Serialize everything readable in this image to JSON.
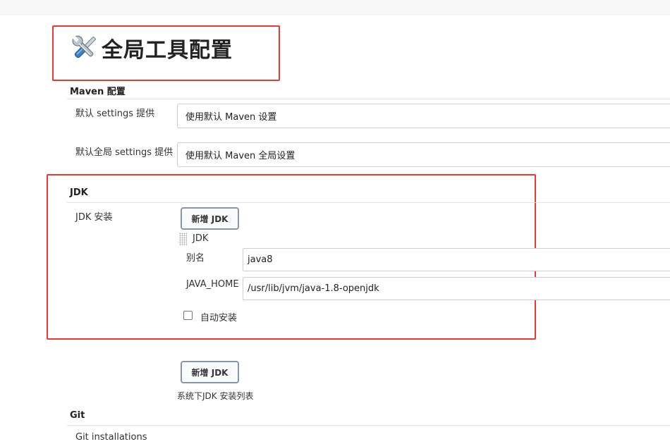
{
  "page": {
    "title": "全局工具配置",
    "icon": "tools-icon"
  },
  "maven": {
    "section_title": "Maven 配置",
    "settings_label": "默认 settings 提供",
    "settings_value": "使用默认 Maven 设置",
    "global_settings_label": "默认全局 settings 提供",
    "global_settings_value": "使用默认 Maven 全局设置"
  },
  "jdk": {
    "section_title": "JDK",
    "install_label": "JDK 安装",
    "add_button": "新增 JDK",
    "entry_header": "JDK",
    "alias_label": "别名",
    "alias_value": "java8",
    "java_home_label": "JAVA_HOME",
    "java_home_value": "/usr/lib/jvm/java-1.8-openjdk",
    "auto_install_label": "自动安装",
    "auto_install_checked": false,
    "add_button_bottom": "新增 JDK",
    "list_hint": "系统下JDK 安装列表"
  },
  "git": {
    "section_title": "Git",
    "installations_label": "Git installations"
  },
  "colors": {
    "highlight_border": "#e53b32",
    "button_border": "#8a96a3"
  }
}
